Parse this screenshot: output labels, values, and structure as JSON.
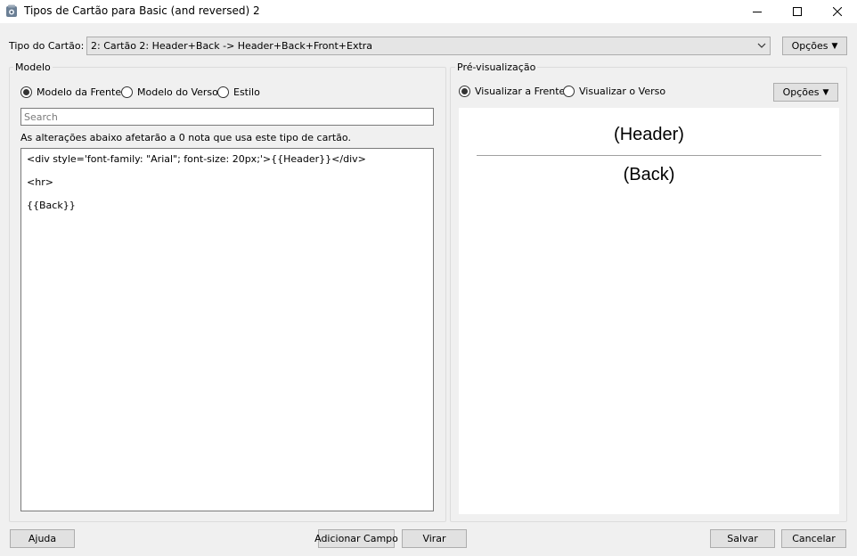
{
  "window": {
    "title": "Tipos de Cartão para Basic (and reversed) 2"
  },
  "card_type": {
    "label": "Tipo do Cartão:",
    "selected": "2: Cartão 2: Header+Back -> Header+Back+Front+Extra",
    "options_button": "Opções",
    "options_arrow": "▼"
  },
  "template_panel": {
    "title": "Modelo",
    "radios": [
      {
        "label": "Modelo da Frente",
        "checked": true
      },
      {
        "label": "Modelo do Verso",
        "checked": false
      },
      {
        "label": "Estilo",
        "checked": false
      }
    ],
    "search_placeholder": "Search",
    "info_text": "As alterações abaixo afetarão a 0 nota que usa este tipo de cartão.",
    "code_lines": [
      "<div style='font-family: \"Arial\"; font-size: 20px;'>{{Header}}</div>",
      "<hr>",
      "{{Back}}"
    ]
  },
  "preview_panel": {
    "title": "Pré-visualização",
    "radios": [
      {
        "label": "Visualizar a Frente",
        "checked": true
      },
      {
        "label": "Visualizar o Verso",
        "checked": false
      }
    ],
    "options_button": "Opções",
    "options_arrow": "▼",
    "header_text": "(Header)",
    "back_text": "(Back)"
  },
  "footer": {
    "help": "Ajuda",
    "add_field": "Adicionar Campo",
    "flip": "Virar",
    "save": "Salvar",
    "cancel": "Cancelar"
  }
}
